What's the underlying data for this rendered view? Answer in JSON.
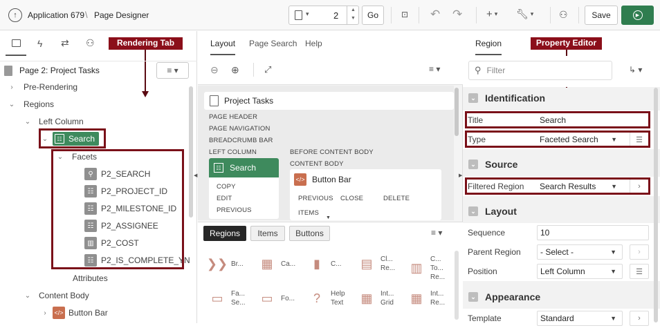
{
  "topbar": {
    "app_label": "Application 679",
    "separator": "\\",
    "page_designer_label": "Page Designer",
    "page_number": "2",
    "go_label": "Go",
    "save_label": "Save"
  },
  "left_panel": {
    "page_title": "Page 2: Project Tasks",
    "tree": {
      "pre_rendering": "Pre-Rendering",
      "regions": "Regions",
      "left_column": "Left Column",
      "search_node": "Search",
      "facets": "Facets",
      "facet_items": [
        "P2_SEARCH",
        "P2_PROJECT_ID",
        "P2_MILESTONE_ID",
        "P2_ASSIGNEE",
        "P2_COST",
        "P2_IS_COMPLETE_YN"
      ],
      "attributes": "Attributes",
      "content_body": "Content Body",
      "button_bar": "Button Bar"
    },
    "callout": "Rendering Tab"
  },
  "middle_panel": {
    "tabs": [
      "Layout",
      "Page Search",
      "Help"
    ],
    "layout": {
      "page_title": "Project Tasks",
      "labels": [
        "PAGE HEADER",
        "PAGE NAVIGATION",
        "BREADCRUMB BAR",
        "LEFT COLUMN"
      ],
      "search_region": "Search",
      "search_actions": [
        "COPY",
        "EDIT",
        "PREVIOUS"
      ],
      "before_content_body": "BEFORE CONTENT BODY",
      "content_body": "CONTENT BODY",
      "button_bar": "Button Bar",
      "button_bar_actions": [
        "PREVIOUS",
        "CLOSE",
        "DELETE"
      ],
      "items_label": "ITEMS"
    },
    "gallery_tabs": [
      "Regions",
      "Items",
      "Buttons"
    ],
    "gallery_items": [
      {
        "label1": "Br...",
        "label2": ""
      },
      {
        "label1": "Ca...",
        "label2": ""
      },
      {
        "label1": "C...",
        "label2": ""
      },
      {
        "label1": "Cl...",
        "label2": "Re..."
      },
      {
        "label1": "C...",
        "label2": "To...",
        "label3": "Re..."
      },
      {
        "label1": "Fa...",
        "label2": "Se..."
      },
      {
        "label1": "Fo...",
        "label2": ""
      },
      {
        "label1": "Help",
        "label2": "Text"
      },
      {
        "label1": "Int...",
        "label2": "Grid"
      },
      {
        "label1": "Int...",
        "label2": "Re..."
      }
    ]
  },
  "right_panel": {
    "tab": "Region",
    "filter_placeholder": "Filter",
    "callout": "Property Editor",
    "sections": {
      "identification": "Identification",
      "source": "Source",
      "layout": "Layout",
      "appearance": "Appearance"
    },
    "props": {
      "title_label": "Title",
      "title_value": "Search",
      "type_label": "Type",
      "type_value": "Faceted Search",
      "filtered_region_label": "Filtered Region",
      "filtered_region_value": "Search Results",
      "sequence_label": "Sequence",
      "sequence_value": "10",
      "parent_region_label": "Parent Region",
      "parent_region_value": "- Select -",
      "position_label": "Position",
      "position_value": "Left Column",
      "template_label": "Template",
      "template_value": "Standard"
    }
  },
  "colors": {
    "callout_red": "#8b0f1a",
    "search_green": "#3e8a5d",
    "run_green": "#2f7d4f",
    "button_bar_orange": "#c96f4f"
  }
}
